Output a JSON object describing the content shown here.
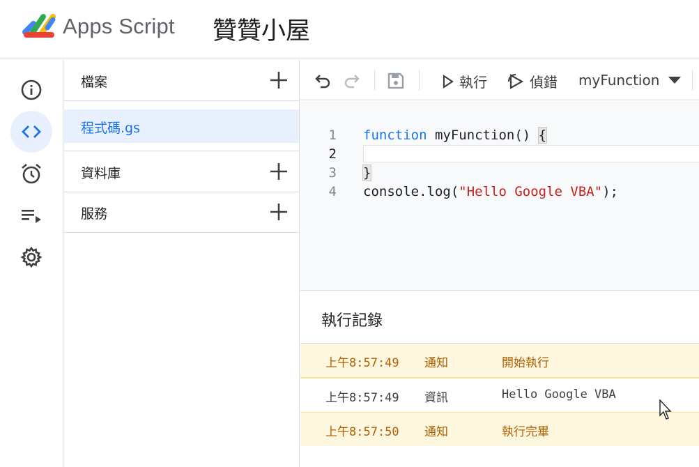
{
  "header": {
    "app_name": "Apps Script",
    "project_name": "贊贊小屋"
  },
  "rail": {
    "items": [
      {
        "icon": "info-icon"
      },
      {
        "icon": "code-icon",
        "active": true
      },
      {
        "icon": "alarm-clock-icon"
      },
      {
        "icon": "playlist-play-icon"
      },
      {
        "icon": "gear-icon"
      }
    ]
  },
  "files": {
    "sections": {
      "files_label": "檔案",
      "libraries_label": "資料庫",
      "services_label": "服務"
    },
    "items": [
      {
        "label": "程式碼.gs",
        "selected": true
      }
    ]
  },
  "toolbar": {
    "run_label": "執行",
    "debug_label": "偵錯",
    "function_select": "myFunction"
  },
  "editor": {
    "lines": [
      {
        "n": "1",
        "keyword": "function",
        "rest": " myFunction() ",
        "brace": "{"
      },
      {
        "n": "2"
      },
      {
        "n": "3",
        "brace": "}"
      },
      {
        "n": "4",
        "prefix": "console.log(",
        "string": "\"Hello Google VBA\"",
        "suffix": ");"
      }
    ]
  },
  "log": {
    "title": "執行記錄",
    "rows": [
      {
        "time": "上午8:57:49",
        "level": "通知",
        "message": "開始執行"
      },
      {
        "time": "上午8:57:49",
        "level": "資訊",
        "message": "Hello Google VBA"
      },
      {
        "time": "上午8:57:50",
        "level": "通知",
        "message": "執行完畢"
      }
    ]
  },
  "colors": {
    "accent": "#1a73e8",
    "active_bg": "#e8f0fe",
    "notice_bg": "#fef7e0",
    "notice_text": "#b06000"
  }
}
